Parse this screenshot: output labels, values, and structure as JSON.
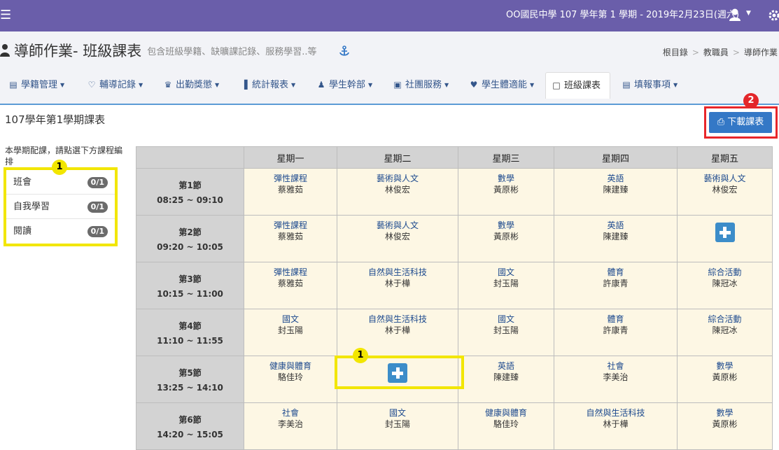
{
  "topbar": {
    "menu_icon": "hamburger-icon",
    "school_info": "OO國民中學 107 學年第 1 學期 - 2019年2月23日(週六)",
    "user_icon": "user-icon",
    "settings_icon": "gear-icon"
  },
  "header": {
    "title": "導師作業- 班級課表",
    "subtitle": "包含班級學籍、缺曠課記錄、服務學習..等",
    "breadcrumb": [
      "根目錄",
      "教職員",
      "導師作業"
    ]
  },
  "tabs": [
    {
      "label": "學籍管理",
      "icon": "id-card-icon"
    },
    {
      "label": "輔導記錄",
      "icon": "heart-icon"
    },
    {
      "label": "出勤獎懲",
      "icon": "trophy-icon"
    },
    {
      "label": "統計報表",
      "icon": "bar-chart-icon"
    },
    {
      "label": "學生幹部",
      "icon": "person-icon"
    },
    {
      "label": "社團服務",
      "icon": "group-icon"
    },
    {
      "label": "學生體適能",
      "icon": "heartbeat-icon"
    },
    {
      "label": "班級課表",
      "icon": "edit-icon",
      "active": true
    },
    {
      "label": "填報事項",
      "icon": "form-icon"
    }
  ],
  "section_title": "107學年第1學期課表",
  "download_button": "下載課表",
  "callouts": {
    "one": "1",
    "two": "2"
  },
  "colors": {
    "topbar": "#6a5eaa",
    "highlight": "#f2e600",
    "callout_red": "#e3262a",
    "button_blue": "#3478c6"
  },
  "electives": {
    "note": "本學期配課，請點選下方課程編排",
    "items": [
      {
        "name": "班會",
        "count": "0/1"
      },
      {
        "name": "自我學習",
        "count": "0/1"
      },
      {
        "name": "閱讀",
        "count": "0/1"
      }
    ]
  },
  "schedule": {
    "days": [
      "星期一",
      "星期二",
      "星期三",
      "星期四",
      "星期五"
    ],
    "periods": [
      {
        "name": "第1節",
        "time": "08:25 ~ 09:10",
        "cells": [
          {
            "subject": "彈性課程",
            "teacher": "蔡雅茹"
          },
          {
            "subject": "藝術與人文",
            "teacher": "林俊宏"
          },
          {
            "subject": "數學",
            "teacher": "黃原彬"
          },
          {
            "subject": "英語",
            "teacher": "陳建臻"
          },
          {
            "subject": "藝術與人文",
            "teacher": "林俊宏"
          }
        ]
      },
      {
        "name": "第2節",
        "time": "09:20 ~ 10:05",
        "cells": [
          {
            "subject": "彈性課程",
            "teacher": "蔡雅茹"
          },
          {
            "subject": "藝術與人文",
            "teacher": "林俊宏"
          },
          {
            "subject": "數學",
            "teacher": "黃原彬"
          },
          {
            "subject": "英語",
            "teacher": "陳建臻"
          },
          {
            "empty": true
          }
        ]
      },
      {
        "name": "第3節",
        "time": "10:15 ~ 11:00",
        "cells": [
          {
            "subject": "彈性課程",
            "teacher": "蔡雅茹"
          },
          {
            "subject": "自然與生活科技",
            "teacher": "林于樺"
          },
          {
            "subject": "國文",
            "teacher": "封玉陽"
          },
          {
            "subject": "體育",
            "teacher": "許康青"
          },
          {
            "subject": "綜合活動",
            "teacher": "陳冠冰"
          }
        ]
      },
      {
        "name": "第4節",
        "time": "11:10 ~ 11:55",
        "cells": [
          {
            "subject": "國文",
            "teacher": "封玉陽"
          },
          {
            "subject": "自然與生活科技",
            "teacher": "林于樺"
          },
          {
            "subject": "國文",
            "teacher": "封玉陽"
          },
          {
            "subject": "體育",
            "teacher": "許康青"
          },
          {
            "subject": "綜合活動",
            "teacher": "陳冠冰"
          }
        ]
      },
      {
        "name": "第5節",
        "time": "13:25 ~ 14:10",
        "cells": [
          {
            "subject": "健康與體育",
            "teacher": "駱佳玲"
          },
          {
            "empty": true
          },
          {
            "subject": "英語",
            "teacher": "陳建臻"
          },
          {
            "subject": "社會",
            "teacher": "李美治"
          },
          {
            "subject": "數學",
            "teacher": "黃原彬"
          }
        ]
      },
      {
        "name": "第6節",
        "time": "14:20 ~ 15:05",
        "cells": [
          {
            "subject": "社會",
            "teacher": "李美治"
          },
          {
            "subject": "國文",
            "teacher": "封玉陽"
          },
          {
            "subject": "健康與體育",
            "teacher": "駱佳玲"
          },
          {
            "subject": "自然與生活科技",
            "teacher": "林于樺"
          },
          {
            "subject": "數學",
            "teacher": "黃原彬"
          }
        ]
      }
    ]
  }
}
